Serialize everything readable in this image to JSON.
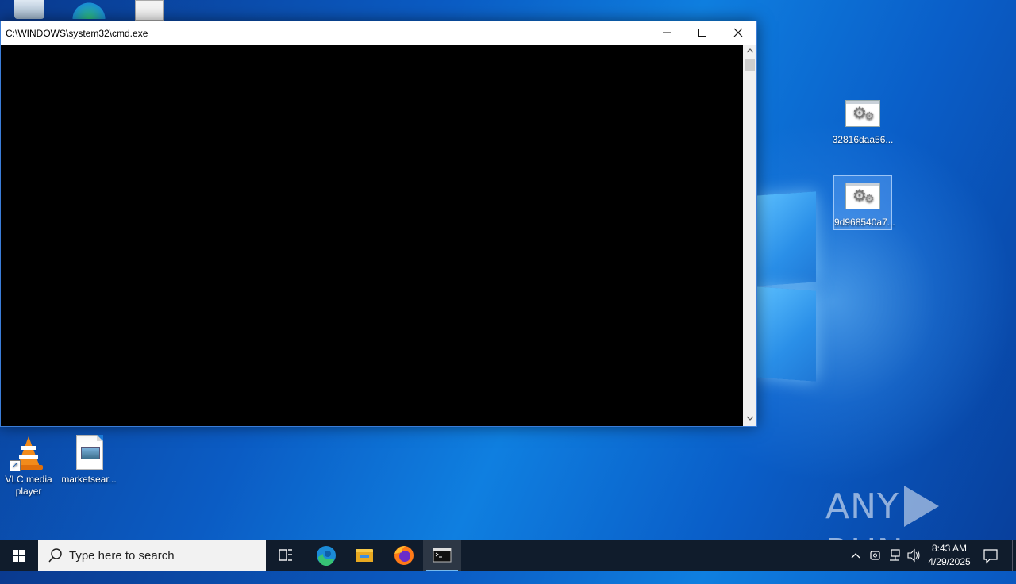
{
  "window": {
    "title": "C:\\WINDOWS\\system32\\cmd.exe",
    "controls": {
      "minimize": "minimize-icon",
      "maximize": "maximize-icon",
      "close": "close-icon"
    }
  },
  "desktop": {
    "icons": [
      {
        "label": "32816daa56...",
        "icon": "settings-file-icon"
      },
      {
        "label": "9d968540a7...",
        "icon": "settings-file-icon",
        "selected": true
      },
      {
        "label": "VLC media player",
        "icon": "vlc-icon"
      },
      {
        "label": "marketsear...",
        "icon": "image-file-icon"
      }
    ]
  },
  "watermark": {
    "left": "ANY",
    "right": "RUN"
  },
  "taskbar": {
    "search_placeholder": "Type here to search",
    "apps": [
      "task-view-icon",
      "edge-icon",
      "file-explorer-icon",
      "firefox-icon",
      "cmd-icon"
    ],
    "active_app": "cmd-icon",
    "clock": {
      "time": "8:43 AM",
      "date": "4/29/2025"
    }
  },
  "colors": {
    "accent": "#0078d7",
    "taskbar": "#101c2c",
    "console": "#000000"
  }
}
